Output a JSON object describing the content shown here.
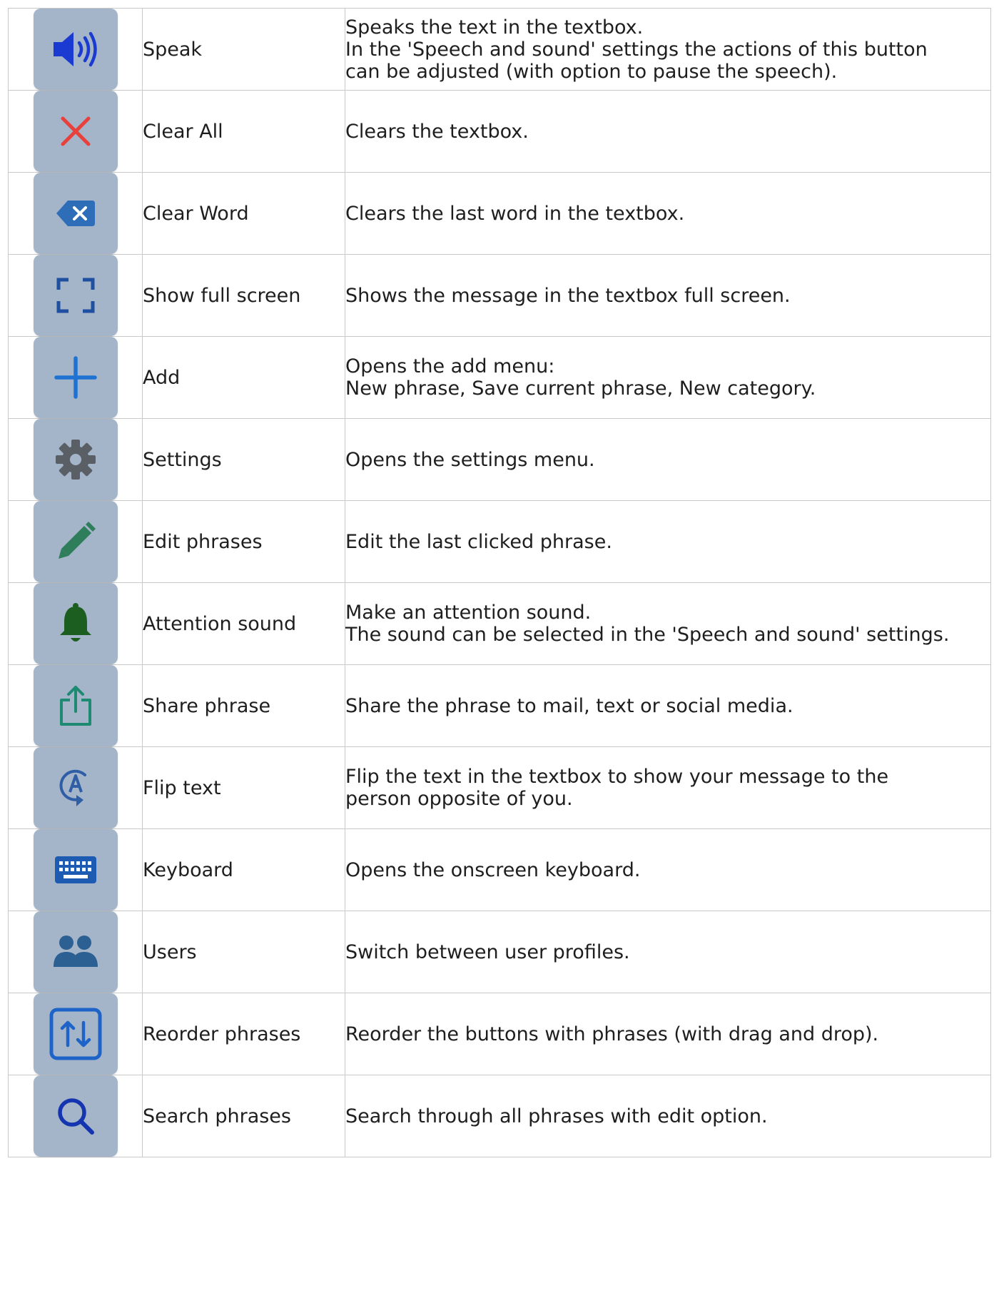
{
  "rows": [
    {
      "icon": "speaker-icon",
      "name": "Speak",
      "description": [
        "Speaks the text in the textbox.",
        "In the 'Speech and sound' settings the actions of this button",
        "can be adjusted (with option to pause the speech)."
      ]
    },
    {
      "icon": "close-icon",
      "name": "Clear All",
      "description": [
        "Clears the textbox."
      ]
    },
    {
      "icon": "backspace-icon",
      "name": "Clear Word",
      "description": [
        "Clears the last word in the textbox."
      ]
    },
    {
      "icon": "fullscreen-icon",
      "name": "Show full screen",
      "description": [
        "Shows the message in the textbox full screen."
      ]
    },
    {
      "icon": "plus-icon",
      "name": "Add",
      "description": [
        "Opens the add menu:",
        "New phrase, Save current phrase, New category."
      ]
    },
    {
      "icon": "gear-icon",
      "name": "Settings",
      "description": [
        "Opens the settings menu."
      ]
    },
    {
      "icon": "pencil-icon",
      "name": "Edit phrases",
      "description": [
        "Edit the last clicked phrase."
      ]
    },
    {
      "icon": "bell-icon",
      "name": "Attention sound",
      "description": [
        "Make an attention sound.",
        "The sound can be selected in the 'Speech and sound' settings."
      ]
    },
    {
      "icon": "share-icon",
      "name": "Share phrase",
      "description": [
        "Share the phrase to mail, text or social media."
      ]
    },
    {
      "icon": "flip-text-icon",
      "name": "Flip text",
      "description": [
        "Flip the text in the textbox to show your message to the",
        "person opposite of you."
      ]
    },
    {
      "icon": "keyboard-icon",
      "name": "Keyboard",
      "description": [
        "Opens the onscreen keyboard."
      ]
    },
    {
      "icon": "users-icon",
      "name": "Users",
      "description": [
        "Switch between user profiles."
      ]
    },
    {
      "icon": "reorder-icon",
      "name": "Reorder phrases",
      "description": [
        "Reorder the buttons with phrases (with drag and drop)."
      ]
    },
    {
      "icon": "search-icon",
      "name": "Search phrases",
      "description": [
        "Search through all phrases with edit option."
      ]
    }
  ],
  "colors": {
    "button_bg": "#a4b5c9",
    "speaker": "#1a3ad1",
    "close": "#e8403a",
    "backspace": "#2e6db8",
    "fullscreen": "#1f4fa0",
    "plus": "#1e73d2",
    "gear": "#5a5f66",
    "pencil": "#2e7d5b",
    "bell": "#1b5e20",
    "share": "#1e8a72",
    "flip": "#2f5ea6",
    "keyboard": "#1d5ab2",
    "users": "#2c5f92",
    "reorder": "#1e64c8",
    "search": "#1535b0"
  }
}
